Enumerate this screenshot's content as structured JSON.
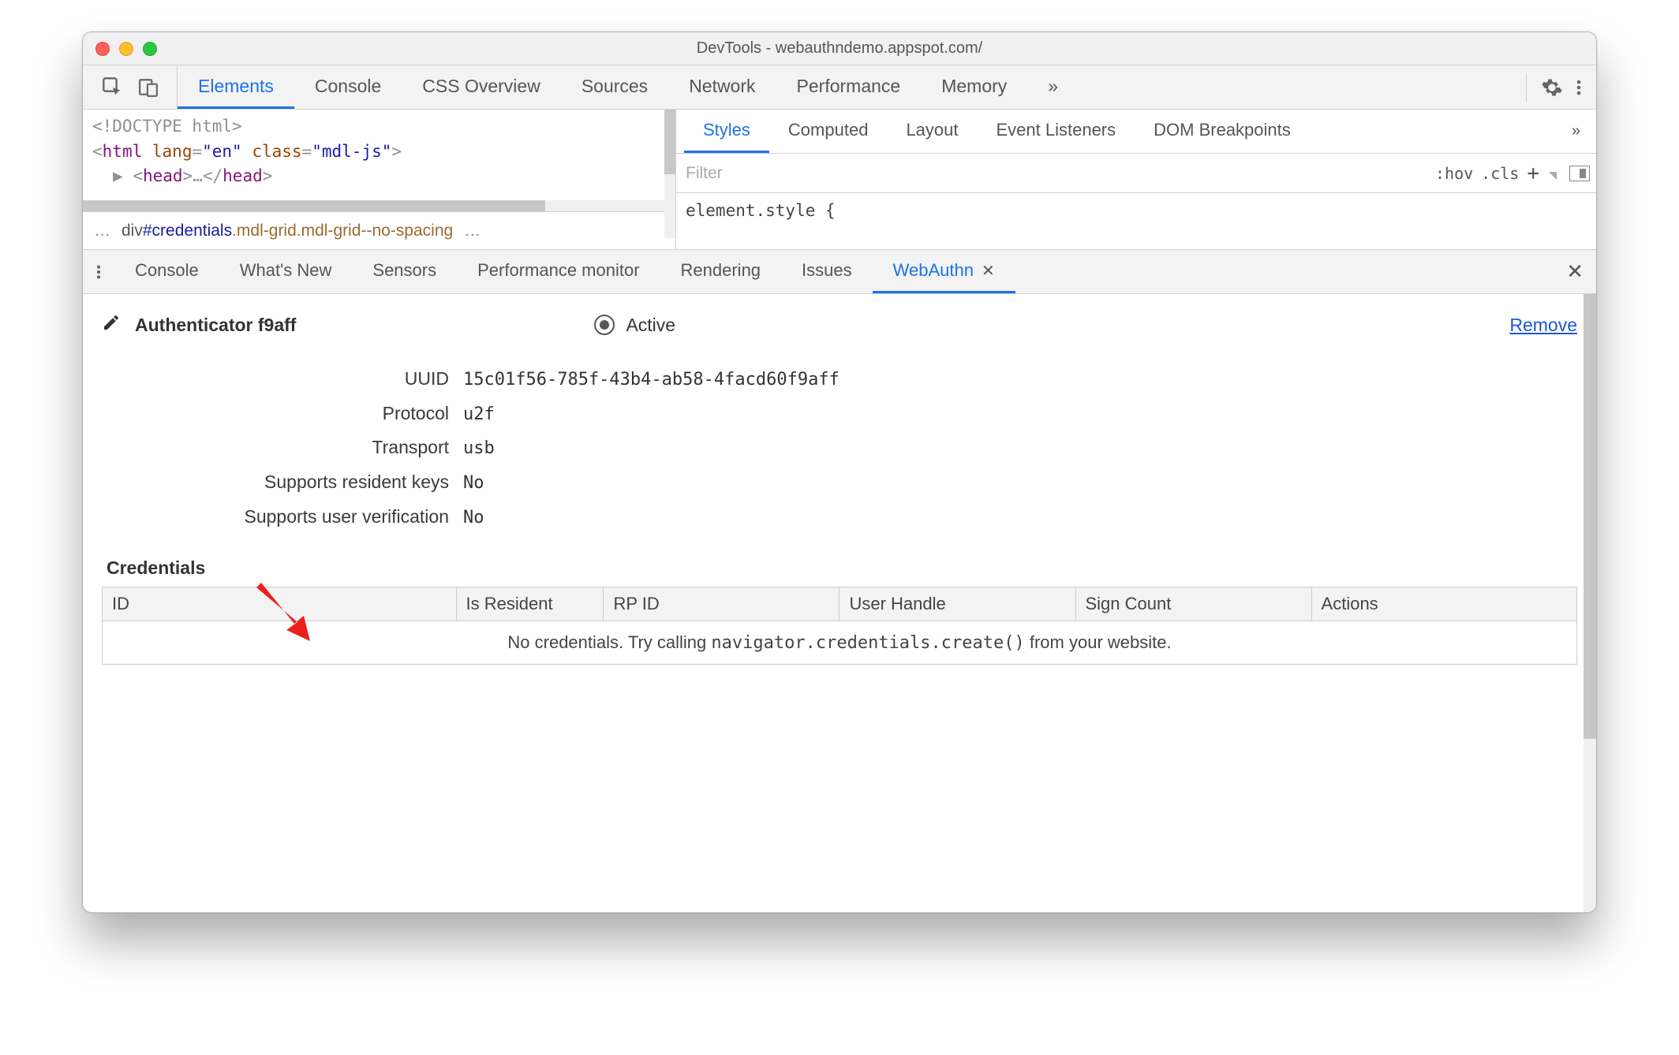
{
  "window": {
    "title": "DevTools - webauthndemo.appspot.com/"
  },
  "top_tabs": {
    "items": [
      {
        "label": "Elements",
        "active": true
      },
      {
        "label": "Console"
      },
      {
        "label": "CSS Overview"
      },
      {
        "label": "Sources"
      },
      {
        "label": "Network"
      },
      {
        "label": "Performance"
      },
      {
        "label": "Memory"
      }
    ],
    "overflow": "»"
  },
  "source": {
    "line1_text": "<!DOCTYPE html>",
    "line2": {
      "open": "<",
      "tag": "html",
      "a1n": "lang",
      "a1v": "\"en\"",
      "a2n": "class",
      "a2v": "\"mdl-js\"",
      "close": ">"
    },
    "line3": {
      "tri": "▶",
      "open": "<",
      "tag": "head",
      "close": ">",
      "ell": "…",
      "open2": "</",
      "close2": ">"
    }
  },
  "breadcrumb": {
    "left_ell": "…",
    "prefix": "div",
    "id": "#credentials",
    "classes": ".mdl-grid.mdl-grid--no-spacing",
    "right_ell": "…"
  },
  "sub_tabs": {
    "items": [
      {
        "label": "Styles",
        "active": true
      },
      {
        "label": "Computed"
      },
      {
        "label": "Layout"
      },
      {
        "label": "Event Listeners"
      },
      {
        "label": "DOM Breakpoints"
      }
    ],
    "overflow": "»"
  },
  "filter": {
    "placeholder": "Filter",
    "hov": ":hov",
    "cls": ".cls",
    "plus": "+"
  },
  "el_style_text": "element.style {",
  "drawer_tabs": {
    "items": [
      {
        "label": "Console"
      },
      {
        "label": "What's New"
      },
      {
        "label": "Sensors"
      },
      {
        "label": "Performance monitor"
      },
      {
        "label": "Rendering"
      },
      {
        "label": "Issues"
      },
      {
        "label": "WebAuthn",
        "active": true,
        "closable": true
      }
    ]
  },
  "authenticator": {
    "name": "Authenticator f9aff",
    "active_label": "Active",
    "remove_label": "Remove",
    "rows": [
      {
        "label": "UUID",
        "value": "15c01f56-785f-43b4-ab58-4facd60f9aff"
      },
      {
        "label": "Protocol",
        "value": "u2f"
      },
      {
        "label": "Transport",
        "value": "usb"
      },
      {
        "label": "Supports resident keys",
        "value": "No"
      },
      {
        "label": "Supports user verification",
        "value": "No"
      }
    ]
  },
  "credentials": {
    "title": "Credentials",
    "columns": [
      "ID",
      "Is Resident",
      "RP ID",
      "User Handle",
      "Sign Count",
      "Actions"
    ],
    "empty_pre": "No credentials. Try calling ",
    "empty_code": "navigator.credentials.create()",
    "empty_post": " from your website."
  }
}
